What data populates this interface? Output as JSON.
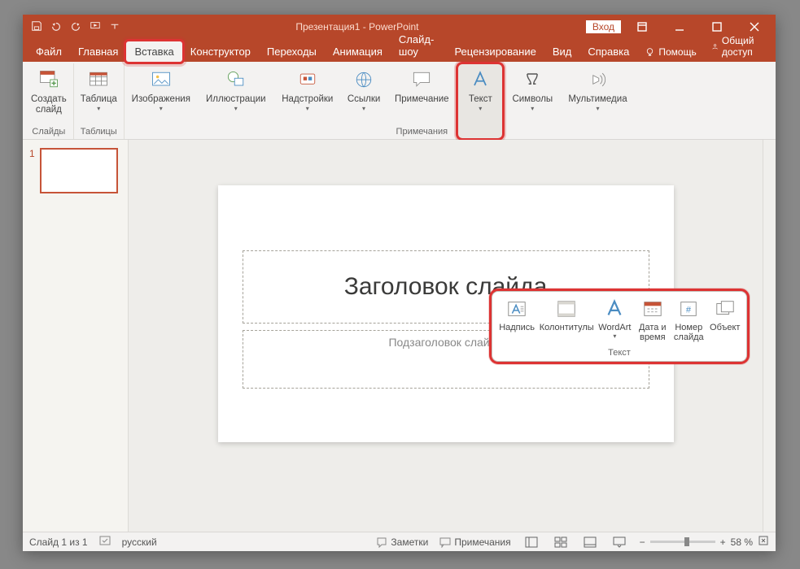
{
  "titlebar": {
    "title": "Презентация1 - PowerPoint",
    "signin": "Вход"
  },
  "tabs": {
    "file": "Файл",
    "home": "Главная",
    "insert": "Вставка",
    "design": "Конструктор",
    "transitions": "Переходы",
    "animations": "Анимация",
    "slideshow": "Слайд-шоу",
    "review": "Рецензирование",
    "view": "Вид",
    "help": "Справка",
    "tellme": "Помощь",
    "share": "Общий доступ"
  },
  "ribbon": {
    "slides": {
      "group": "Слайды",
      "new_slide": "Создать\nслайд"
    },
    "tables": {
      "group": "Таблицы",
      "table": "Таблица"
    },
    "images": {
      "images": "Изображения"
    },
    "illustrations": {
      "illustrations": "Иллюстрации"
    },
    "addins": {
      "addins": "Надстройки"
    },
    "links": {
      "links": "Ссылки"
    },
    "comments": {
      "group": "Примечания",
      "new_comment": "Примечание"
    },
    "text": {
      "text": "Текст"
    },
    "symbols": {
      "symbols": "Символы"
    },
    "media": {
      "media": "Мультимедиа"
    }
  },
  "popup": {
    "group": "Текст",
    "textbox": "Надпись",
    "headerfooter": "Колонтитулы",
    "wordart": "WordArt",
    "datetime": "Дата и\nвремя",
    "slidenumber": "Номер\nслайда",
    "object": "Объект"
  },
  "thumbs": {
    "first_index": "1"
  },
  "slide": {
    "title_placeholder": "Заголовок слайда",
    "subtitle_placeholder": "Подзаголовок слайда"
  },
  "status": {
    "slide_pos": "Слайд 1 из 1",
    "language": "русский",
    "notes": "Заметки",
    "comments": "Примечания",
    "zoom": "58 %"
  }
}
